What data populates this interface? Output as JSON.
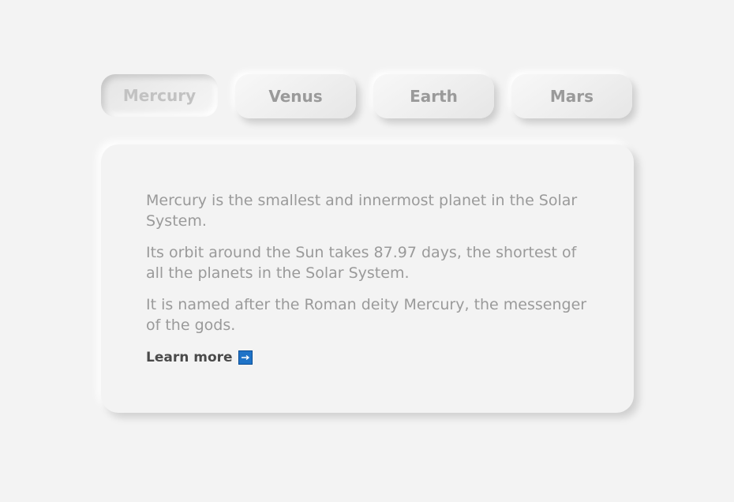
{
  "tabs": [
    {
      "label": "Mercury",
      "active": true
    },
    {
      "label": "Venus",
      "active": false
    },
    {
      "label": "Earth",
      "active": false
    },
    {
      "label": "Mars",
      "active": false
    }
  ],
  "content": {
    "paragraphs": [
      "Mercury is the smallest and innermost planet in the Solar System.",
      "Its orbit around the Sun takes 87.97 days, the shortest of all the planets in the Solar System.",
      "It is named after the Roman deity Mercury, the messenger of the gods."
    ],
    "learn_more": "Learn more",
    "learn_more_icon": "arrow-right-icon"
  },
  "colors": {
    "background": "#f3f3f3",
    "text": "#9a9a9a",
    "link": "#4a4a4a",
    "arrow_box": "#1f73c7"
  }
}
